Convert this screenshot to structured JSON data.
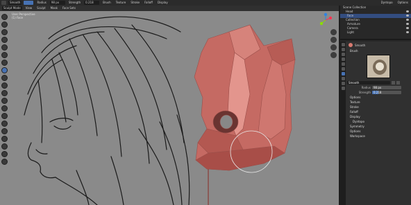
{
  "topbar": {
    "mode_name": "Sculpt Mode",
    "brush_name": "Smooth",
    "radius_label": "Radius",
    "radius_value": "98 px",
    "strength_label": "Strength",
    "strength_value": "0.218",
    "menus": [
      "Brush",
      "Texture",
      "Stroke",
      "Falloff",
      "Display"
    ],
    "right_items": [
      "Dyntopo",
      "Options"
    ]
  },
  "subbar": {
    "items": [
      "Sculpt Mode",
      "View",
      "Sculpt",
      "Mask",
      "Face Sets"
    ]
  },
  "viewport": {
    "info_line1": "User Perspective",
    "info_line2": "(1) Face"
  },
  "outliner": {
    "rows": [
      {
        "label": "Scene Collection",
        "selected": false
      },
      {
        "label": "Head",
        "selected": false
      },
      {
        "label": "Face",
        "selected": true
      },
      {
        "label": "Collection",
        "selected": false
      },
      {
        "label": "Armature",
        "selected": false
      },
      {
        "label": "Camera",
        "selected": false
      },
      {
        "label": "Light",
        "selected": false
      }
    ]
  },
  "properties": {
    "brush_header": "Smooth",
    "brushes_section": "Brush",
    "brush_field_name": "Smooth",
    "radius_label": "Radius",
    "radius_value": "98 px",
    "strength_label": "Strength",
    "strength_value": "0.218",
    "strength_fraction": 0.218,
    "sections": [
      "Options",
      "Texture",
      "Stroke",
      "Falloff",
      "Display",
      "Dyntopo",
      "Symmetry",
      "Options",
      "Workspace"
    ]
  },
  "colors": {
    "accent": "#4772b3",
    "viewport_bg": "#8a8a8a",
    "mesh": "#c56a63"
  }
}
